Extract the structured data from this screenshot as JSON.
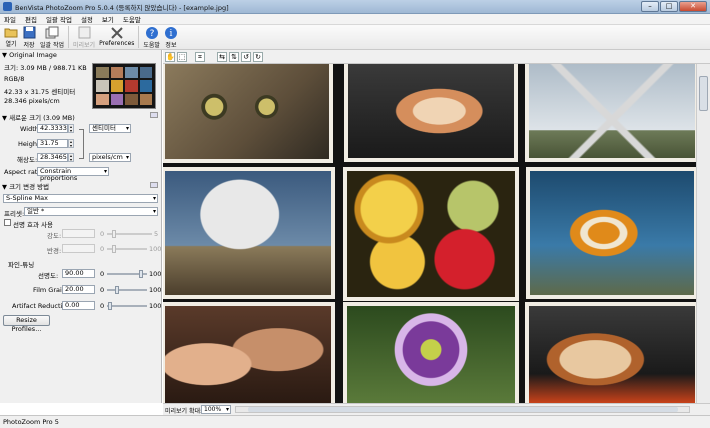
{
  "window": {
    "title": "BenVista PhotoZoom Pro 5.0.4 (등록하지 않았습니다) - [example.jpg]",
    "minimize": "–",
    "maximize": "□",
    "close": "✕"
  },
  "menu": [
    "파일",
    "편집",
    "일괄 작업",
    "설정",
    "보기",
    "도움말"
  ],
  "toolbar": {
    "open": "열기",
    "save": "저장",
    "batch": "일괄 작업",
    "preview": "미리보기",
    "preferences": "Preferences",
    "help": "도움말",
    "about": "정보"
  },
  "original": {
    "header": "Original Image",
    "size": "크기: 3.09 MB / 988.71 KB",
    "mode": "RGB/8",
    "dimensions": "42.33 x 31.75 센티미터",
    "resolution": "28.346 pixels/cm"
  },
  "new_size": {
    "header": "새로운 크기 (3.09 MB)",
    "width_label": "Width:",
    "width_value": "42.3333",
    "width_unit": "센티미터",
    "height_label": "Height:",
    "height_value": "31.75",
    "res_label": "해상도:",
    "res_value": "28.3465",
    "res_unit": "pixels/cm",
    "aspect_label": "Aspect ratio:",
    "aspect_value": "Constrain proportions"
  },
  "method": {
    "header": "크기 변경 방법",
    "method_value": "S-Spline Max",
    "preset_label": "프리셋:",
    "preset_value": "일반 *"
  },
  "unsharp": {
    "checkbox_label": "선명 효과 사용",
    "strength_label": "강도:",
    "strength_min": "0",
    "strength_max": "5",
    "radius_label": "반경:",
    "radius_min": "0",
    "radius_max": "100"
  },
  "fine_tune": {
    "header": "파인-튜닝",
    "sharpness_label": "선명도:",
    "sharpness_value": "90.00",
    "sharpness_min": "0",
    "sharpness_max": "100",
    "sharpness_level": 0.9,
    "grain_label": "Film Grain:",
    "grain_value": "20.00",
    "grain_min": "0",
    "grain_max": "100",
    "grain_level": 0.2,
    "artifact_label": "Artifact Reduction:",
    "artifact_value": "0.00",
    "artifact_min": "0",
    "artifact_max": "100",
    "artifact_level": 0.0
  },
  "profiles_button": "Resize Profiles...",
  "preview_zoom": {
    "label": "미리보기 확대:",
    "value": "100%"
  },
  "status": "PhotoZoom Pro 5",
  "colors": {
    "canvas": "#121212",
    "photo_border": "#f1ede4",
    "panel": "#f0f0f0"
  }
}
